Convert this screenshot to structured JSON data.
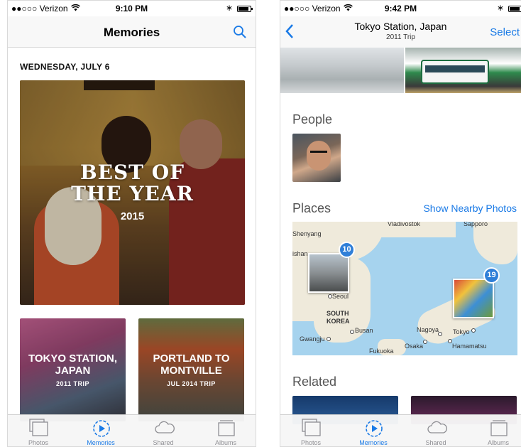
{
  "left": {
    "status": {
      "carrier": "●●○○○ Verizon",
      "wifi": "wifi-icon",
      "time": "9:10 PM",
      "bluetooth": "bluetooth-icon",
      "battery": "battery-icon"
    },
    "nav": {
      "title": "Memories",
      "search_icon": "search-icon"
    },
    "date_heading": "WEDNESDAY, JULY 6",
    "hero": {
      "title_line1": "BEST OF",
      "title_line2": "THE YEAR",
      "subtitle": "2015"
    },
    "cards": [
      {
        "title_line1": "TOKYO STATION,",
        "title_line2": "JAPAN",
        "subtitle": "2011 TRIP"
      },
      {
        "title_line1": "PORTLAND TO",
        "title_line2": "MONTVILLE",
        "subtitle": "JUL 2014 TRIP"
      }
    ],
    "tabs": [
      {
        "label": "Photos",
        "icon": "photos-icon",
        "active": false
      },
      {
        "label": "Memories",
        "icon": "memories-icon",
        "active": true
      },
      {
        "label": "Shared",
        "icon": "cloud-icon",
        "active": false
      },
      {
        "label": "Albums",
        "icon": "albums-icon",
        "active": false
      }
    ]
  },
  "right": {
    "status": {
      "carrier": "●●○○○ Verizon",
      "wifi": "wifi-icon",
      "time": "9:42 PM",
      "bluetooth": "bluetooth-icon",
      "battery": "battery-icon"
    },
    "nav": {
      "back_icon": "chevron-left-icon",
      "title": "Tokyo Station, Japan",
      "subtitle": "2011 Trip",
      "select_label": "Select"
    },
    "people_heading": "People",
    "places_heading": "Places",
    "show_nearby": "Show Nearby Photos",
    "map": {
      "labels": {
        "shenyang": "Shenyang",
        "vladivostok": "Vladivostok",
        "sapporo": "Sapporo",
        "ishan": "ishan",
        "seoul": "Seoul",
        "south_korea_1": "SOUTH",
        "south_korea_2": "KOREA",
        "busan": "Busan",
        "gwangju": "Gwangju",
        "fukuoka": "Fukuoka",
        "nagoya": "Nagoya",
        "tokyo": "Tokyo",
        "osaka": "Osaka",
        "hamamatsu": "Hamamatsu"
      },
      "pins": [
        {
          "count": "10"
        },
        {
          "count": "19"
        }
      ]
    },
    "related_heading": "Related",
    "tabs": [
      {
        "label": "Photos",
        "icon": "photos-icon",
        "active": false
      },
      {
        "label": "Memories",
        "icon": "memories-icon",
        "active": true
      },
      {
        "label": "Shared",
        "icon": "cloud-icon",
        "active": false
      },
      {
        "label": "Albums",
        "icon": "albums-icon",
        "active": false
      }
    ]
  },
  "colors": {
    "accent": "#1a7ae6",
    "tab_inactive": "#8e8e93",
    "map_water": "#a6d3ee",
    "map_land": "#efeadb"
  }
}
